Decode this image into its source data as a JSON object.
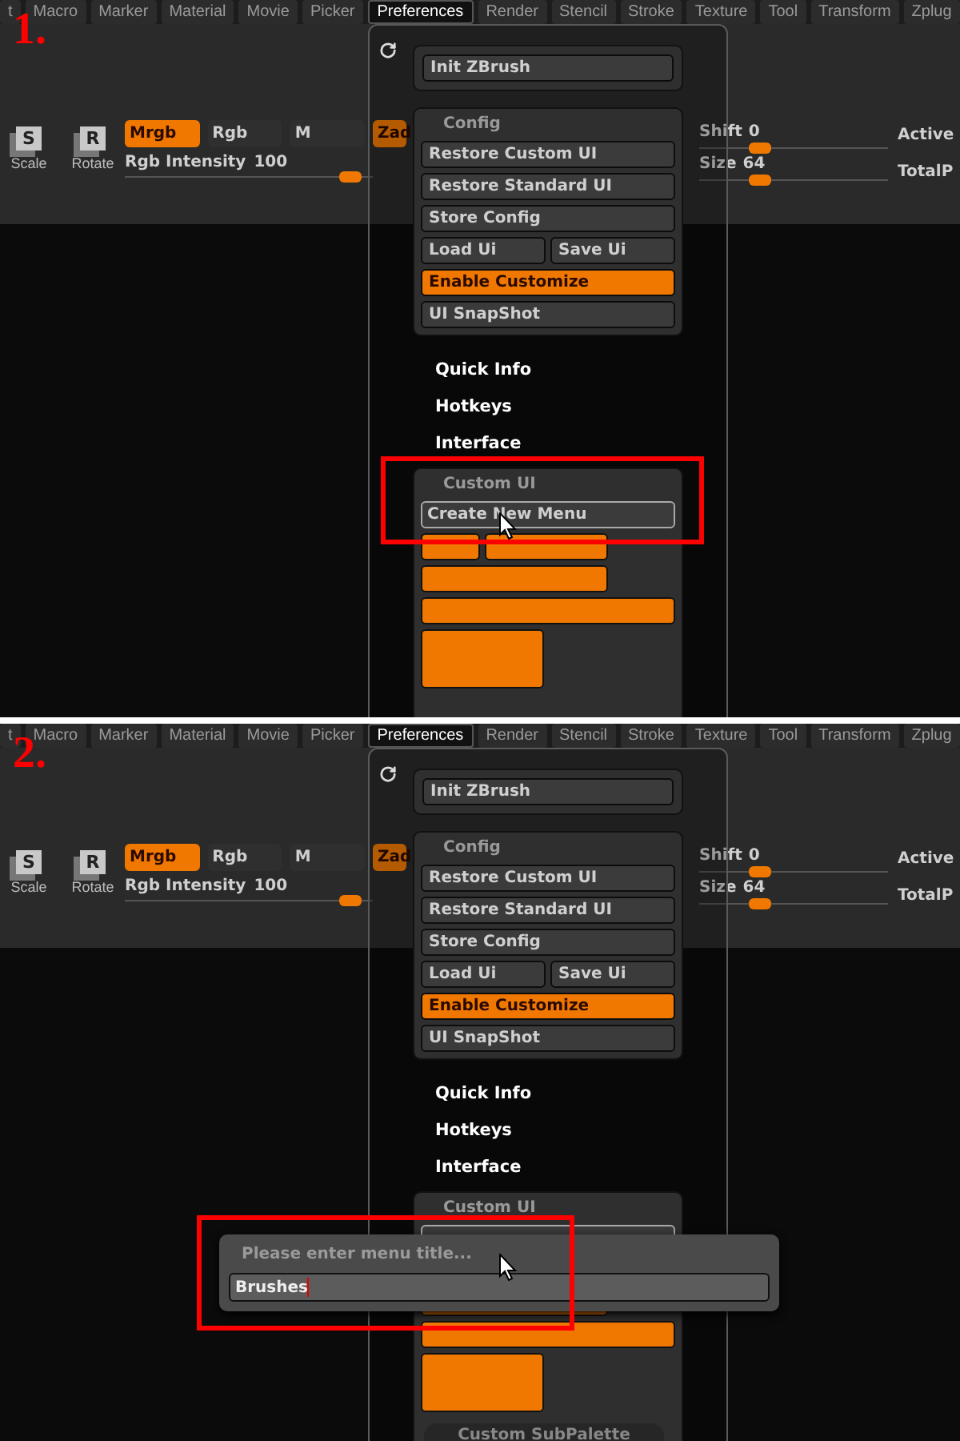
{
  "panels": [
    {
      "step": "1.",
      "menu": [
        {
          "label": "t",
          "selected": false
        },
        {
          "label": "Macro",
          "selected": false
        },
        {
          "label": "Marker",
          "selected": false
        },
        {
          "label": "Material",
          "selected": false
        },
        {
          "label": "Movie",
          "selected": false
        },
        {
          "label": "Picker",
          "selected": false
        },
        {
          "label": "Preferences",
          "selected": true
        },
        {
          "label": "Render",
          "selected": false
        },
        {
          "label": "Stencil",
          "selected": false
        },
        {
          "label": "Stroke",
          "selected": false
        },
        {
          "label": "Texture",
          "selected": false
        },
        {
          "label": "Tool",
          "selected": false
        },
        {
          "label": "Transform",
          "selected": false
        },
        {
          "label": "Zplug",
          "selected": false
        }
      ],
      "tools": [
        {
          "label": "Scale",
          "letter": "S"
        },
        {
          "label": "Rotate",
          "letter": "R"
        }
      ],
      "modes": [
        {
          "label": "Mrgb",
          "selected": true
        },
        {
          "label": "Rgb",
          "selected": false
        },
        {
          "label": "M",
          "selected": false
        },
        {
          "label": "Zad",
          "selected": true
        }
      ],
      "intensity": {
        "label": "Rgb Intensity",
        "reading": "100",
        "level": 0.95
      },
      "right_sliders": [
        {
          "label": "Shift",
          "reading": "0",
          "level": 0.3
        },
        {
          "label": "Size",
          "reading": "64",
          "level": 0.3
        }
      ],
      "right_labels": [
        "Active",
        "TotalP"
      ],
      "dropdown": {
        "init": "Init ZBrush",
        "config_title": "Config",
        "config_buttons": [
          {
            "label": "Restore Custom UI",
            "kind": "full",
            "on": false
          },
          {
            "label": "Restore Standard UI",
            "kind": "full",
            "on": false
          },
          {
            "label": "Store Config",
            "kind": "full",
            "on": false
          },
          {
            "label": "Load Ui",
            "kind": "half",
            "on": false
          },
          {
            "label": "Save Ui",
            "kind": "half",
            "on": false
          },
          {
            "label": "Enable Customize",
            "kind": "full",
            "on": true
          },
          {
            "label": "UI SnapShot",
            "kind": "full",
            "on": false
          }
        ],
        "sections": [
          "Quick Info",
          "Hotkeys",
          "Interface"
        ],
        "custom_title": "Custom UI",
        "create_button": "Create New Menu",
        "create_highlighted": true
      }
    },
    {
      "step": "2.",
      "menu": [
        {
          "label": "t",
          "selected": false
        },
        {
          "label": "Macro",
          "selected": false
        },
        {
          "label": "Marker",
          "selected": false
        },
        {
          "label": "Material",
          "selected": false
        },
        {
          "label": "Movie",
          "selected": false
        },
        {
          "label": "Picker",
          "selected": false
        },
        {
          "label": "Preferences",
          "selected": true
        },
        {
          "label": "Render",
          "selected": false
        },
        {
          "label": "Stencil",
          "selected": false
        },
        {
          "label": "Stroke",
          "selected": false
        },
        {
          "label": "Texture",
          "selected": false
        },
        {
          "label": "Tool",
          "selected": false
        },
        {
          "label": "Transform",
          "selected": false
        },
        {
          "label": "Zplug",
          "selected": false
        }
      ],
      "tools": [
        {
          "label": "Scale",
          "letter": "S"
        },
        {
          "label": "Rotate",
          "letter": "R"
        }
      ],
      "modes": [
        {
          "label": "Mrgb",
          "selected": true
        },
        {
          "label": "Rgb",
          "selected": false
        },
        {
          "label": "M",
          "selected": false
        },
        {
          "label": "Zad",
          "selected": true
        }
      ],
      "intensity": {
        "label": "Rgb Intensity",
        "reading": "100",
        "level": 0.95
      },
      "right_sliders": [
        {
          "label": "Shift",
          "reading": "0",
          "level": 0.3
        },
        {
          "label": "Size",
          "reading": "64",
          "level": 0.3
        }
      ],
      "right_labels": [
        "Active",
        "TotalP"
      ],
      "dropdown": {
        "init": "Init ZBrush",
        "config_title": "Config",
        "config_buttons": [
          {
            "label": "Restore Custom UI",
            "kind": "full",
            "on": false
          },
          {
            "label": "Restore Standard UI",
            "kind": "full",
            "on": false
          },
          {
            "label": "Store Config",
            "kind": "full",
            "on": false
          },
          {
            "label": "Load Ui",
            "kind": "half",
            "on": false
          },
          {
            "label": "Save Ui",
            "kind": "half",
            "on": false
          },
          {
            "label": "Enable Customize",
            "kind": "full",
            "on": true
          },
          {
            "label": "UI SnapShot",
            "kind": "full",
            "on": false
          }
        ],
        "sections": [
          "Quick Info",
          "Hotkeys",
          "Interface"
        ],
        "custom_title": "Custom UI",
        "subpalette": "Custom SubPalette",
        "create_highlighted": false
      },
      "dialog": {
        "title": "Please enter menu title...",
        "value": "Brushes",
        "highlighted": true
      }
    }
  ]
}
